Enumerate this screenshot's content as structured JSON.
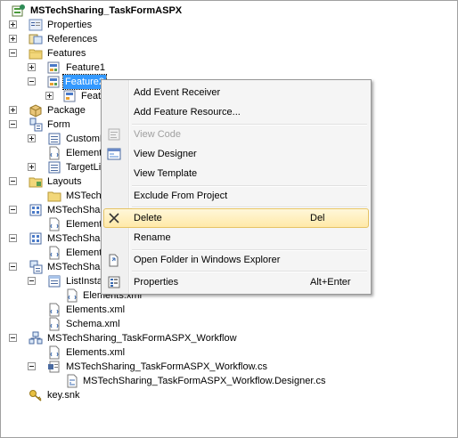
{
  "tree": {
    "root": "MSTechSharing_TaskFormASPX",
    "properties": "Properties",
    "references": "References",
    "features": "Features",
    "feature1": "Feature1",
    "feature2": "Feature2",
    "feature2_child": "Feat",
    "package": "Package",
    "form": "Form",
    "form_custom": "CustomF",
    "form_elements": "Elements",
    "form_target": "TargetLis",
    "layouts": "Layouts",
    "layouts_child": "MSTechS",
    "item_a": "MSTechSharing",
    "item_a_elements": "Elements",
    "item_b": "MSTechSharing",
    "item_b_elements": "Elements",
    "item_c": "MSTechSharing",
    "listinstance": "ListInsta",
    "listinstance_elements": "Elements.xml",
    "item_c_elements": "Elements.xml",
    "item_c_schema": "Schema.xml",
    "workflow": "MSTechSharing_TaskFormASPX_Workflow",
    "workflow_elements": "Elements.xml",
    "workflow_cs": "MSTechSharing_TaskFormASPX_Workflow.cs",
    "workflow_designer": "MSTechSharing_TaskFormASPX_Workflow.Designer.cs",
    "keysnk": "key.snk"
  },
  "menu": {
    "add_event_receiver": "Add Event Receiver",
    "add_feature_resource": "Add Feature Resource...",
    "view_code": "View Code",
    "view_designer": "View Designer",
    "view_template": "View Template",
    "exclude_from_project": "Exclude From Project",
    "delete": "Delete",
    "delete_shortcut": "Del",
    "rename": "Rename",
    "open_folder": "Open Folder in Windows Explorer",
    "properties": "Properties",
    "properties_shortcut": "Alt+Enter"
  },
  "icons": {
    "project": "sharepoint-project-icon",
    "properties": "properties-icon",
    "references": "references-icon",
    "folder": "folder-icon",
    "feature": "feature-icon",
    "package": "package-icon",
    "form": "form-icon",
    "xml": "xml-file-icon",
    "module": "module-icon",
    "list": "list-icon",
    "workflow": "workflow-icon",
    "cs": "csharp-file-icon",
    "key": "key-icon",
    "delete": "delete-x-icon",
    "view_code": "view-code-icon",
    "view_designer": "view-designer-icon",
    "open_folder": "open-folder-icon",
    "menu_properties": "properties-icon"
  },
  "colors": {
    "selection": "#3399ff",
    "menu_highlight": "#ffe9a8",
    "menu_highlight_border": "#e5c365"
  }
}
